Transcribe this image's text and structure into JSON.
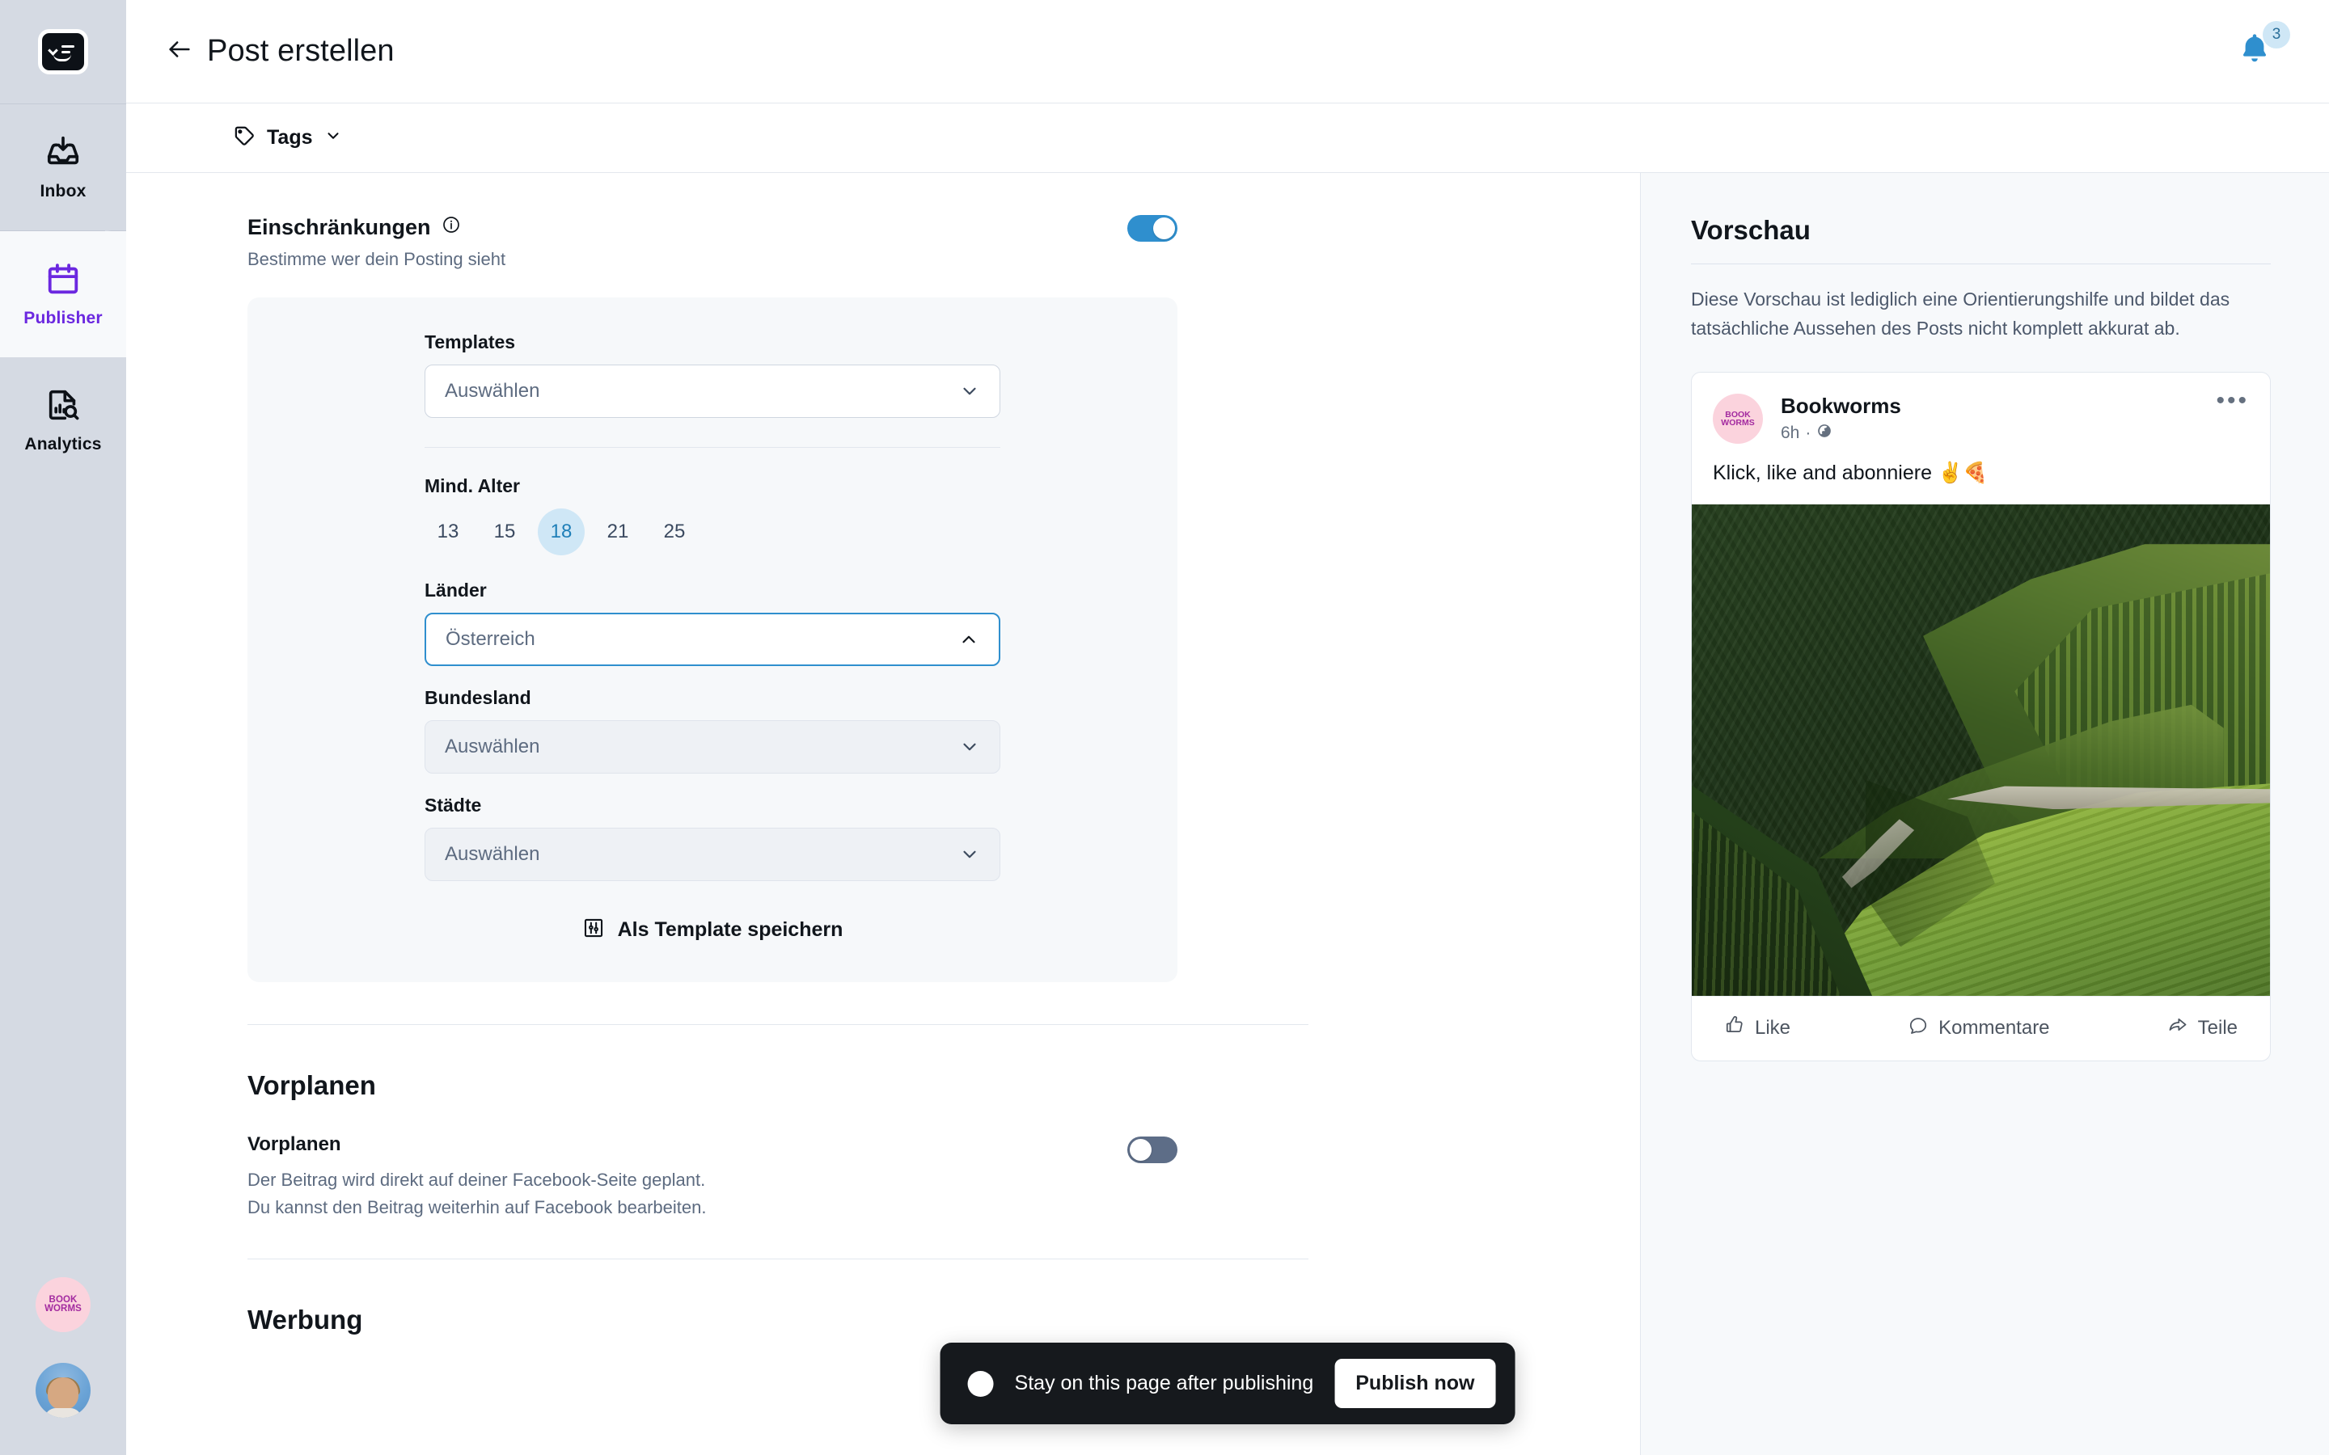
{
  "rail": {
    "logo_name": "app-logo",
    "items": [
      {
        "id": "inbox",
        "label": "Inbox",
        "icon": "inbox-icon",
        "active": false
      },
      {
        "id": "publisher",
        "label": "Publisher",
        "icon": "calendar-icon",
        "active": true
      },
      {
        "id": "analytics",
        "label": "Analytics",
        "icon": "analytics-icon",
        "active": false
      }
    ],
    "brand_avatar_line1": "BOOK",
    "brand_avatar_line2": "WORMS",
    "accent_purple": "#6b28e0",
    "background": "#d5dae3"
  },
  "topbar": {
    "back_icon": "arrow-left-icon",
    "title": "Post erstellen",
    "bell_icon": "bell-icon",
    "notification_count": "3",
    "bell_color": "#2f8fce",
    "badge_bg": "#cfe7f6"
  },
  "tagbar": {
    "tag_icon": "tag-icon",
    "label": "Tags",
    "chevron": "chevron-down-icon"
  },
  "restrictions": {
    "title": "Einschränkungen",
    "info_icon": "info-circle-icon",
    "subtitle": "Bestimme wer dein Posting sieht",
    "toggle_on": true,
    "toggle_on_color": "#2f8fce",
    "fields": {
      "templates": {
        "label": "Templates",
        "value": "Auswählen",
        "disabled": false,
        "open": false
      },
      "min_age": {
        "label": "Mind. Alter",
        "options": [
          "13",
          "15",
          "18",
          "21",
          "25"
        ],
        "selected": "18",
        "selected_bg": "#cfe7f6",
        "selected_fg": "#1f7fb8"
      },
      "countries": {
        "label": "Länder",
        "value": "Österreich",
        "disabled": false,
        "open": true,
        "focus_color": "#2f8fce"
      },
      "state": {
        "label": "Bundesland",
        "value": "Auswählen",
        "disabled": true,
        "open": false
      },
      "cities": {
        "label": "Städte",
        "value": "Auswählen",
        "disabled": true,
        "open": false
      }
    },
    "save_template": {
      "icon": "sliders-square-icon",
      "label": "Als Template speichern"
    }
  },
  "schedule": {
    "section_title": "Vorplanen",
    "row_title": "Vorplanen",
    "toggle_on": false,
    "toggle_off_color": "#5d6d87",
    "description_line1": "Der Beitrag wird direkt auf deiner Facebook-Seite geplant.",
    "description_line2": "Du kannst den Beitrag weiterhin auf Facebook bearbeiten."
  },
  "ads": {
    "section_title": "Werbung"
  },
  "preview": {
    "title": "Vorschau",
    "note": "Diese Vorschau ist lediglich eine Orientierungshilfe und bildet das tatsächliche Aussehen des Posts nicht komplett akkurat ab.",
    "post": {
      "avatar_line1": "BOOK",
      "avatar_line2": "WORMS",
      "author": "Bookworms",
      "time": "6h",
      "audience_icon": "globe-icon",
      "more_icon": "more-horizontal-icon",
      "text": "Klick, like and abonniere ✌️🍕",
      "image_alt": "mountain-meadow-forest-photo",
      "actions": [
        {
          "id": "like",
          "label": "Like",
          "icon": "thumbs-up-icon"
        },
        {
          "id": "comment",
          "label": "Kommentare",
          "icon": "comment-icon"
        },
        {
          "id": "share",
          "label": "Teile",
          "icon": "share-icon"
        }
      ]
    }
  },
  "publish_bar": {
    "radio_name": "stay-on-page-radio",
    "radio_label": "Stay on this page after publishing",
    "button_label": "Publish now",
    "bar_bg": "#16191d"
  }
}
